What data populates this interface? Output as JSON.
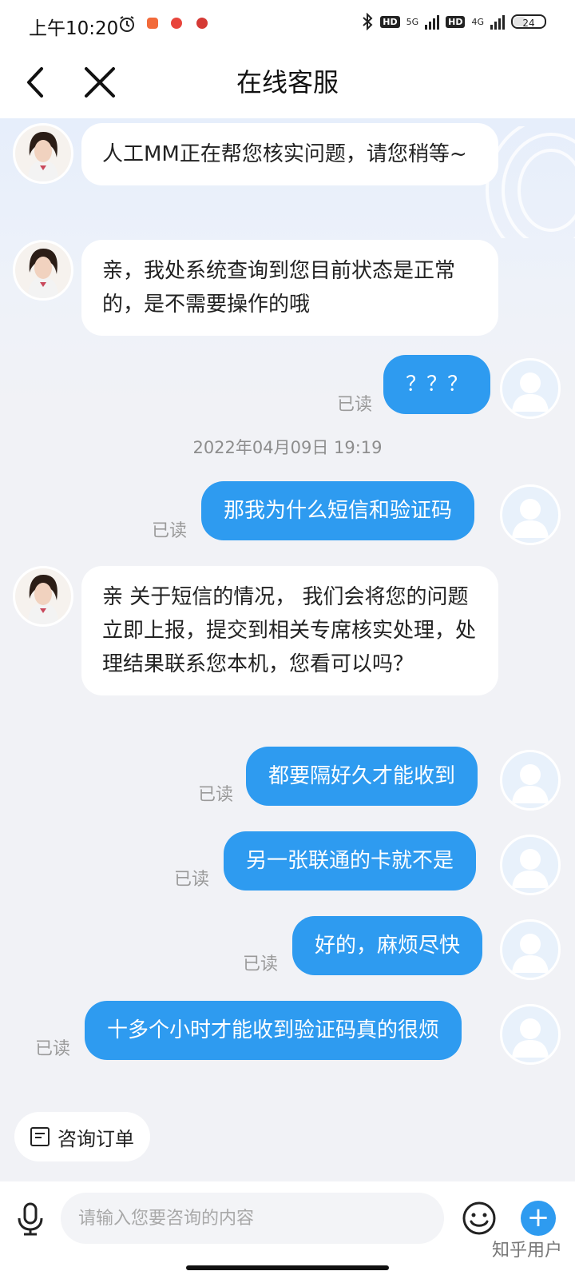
{
  "status_bar": {
    "time": "上午10:20",
    "hd_label": "HD",
    "net1": "5G",
    "net2": "4G",
    "battery": "24"
  },
  "nav": {
    "title": "在线客服"
  },
  "messages": {
    "m1": "人工MM正在帮您核实问题，请您稍等~",
    "m2": "亲，我处系统查询到您目前状态是正常的，是不需要操作的哦",
    "m3": "？？？",
    "timestamp": "2022年04月09日 19:19",
    "m4": "那我为什么短信和验证码",
    "m5": "亲 关于短信的情况，  我们会将您的问题立即上报，提交到相关专席核实处理，处理结果联系您本机，您看可以吗？",
    "m6": "都要隔好久才能收到",
    "m7": "另一张联通的卡就不是",
    "m8": "好的，麻烦尽快",
    "m9": "十多个小时才能收到验证码真的很烦",
    "read_label": "已读"
  },
  "shortcut": {
    "order_label": "咨询订单"
  },
  "input": {
    "placeholder": "请输入您要咨询的内容"
  },
  "watermark": "知乎用户",
  "colors": {
    "accent": "#2e9bf0",
    "background": "#f1f2f6"
  }
}
